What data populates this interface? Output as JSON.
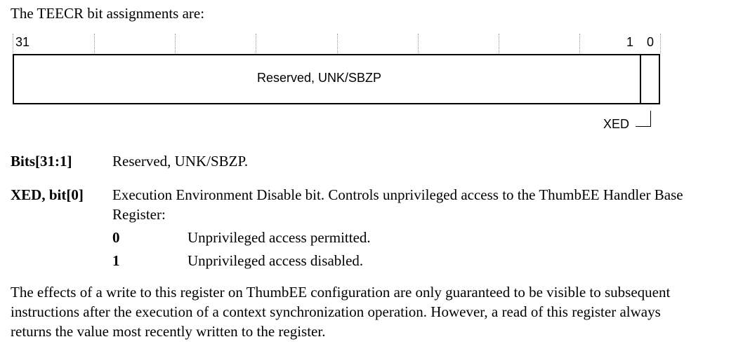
{
  "intro": "The TEECR bit assignments are:",
  "diagram": {
    "bit_high": "31",
    "bit_one": "1",
    "bit_zero": "0",
    "reserved_field_label": "Reserved, UNK/SBZP",
    "xed_field_label": "XED"
  },
  "fields": [
    {
      "name": "Bits[31:1]",
      "description": "Reserved, UNK/SBZP."
    },
    {
      "name": "XED, bit[0]",
      "description_line1": "Execution Environment Disable bit. Controls unprivileged access to the ThumbEE Handler Base",
      "description_line2": "Register:",
      "values": [
        {
          "value": "0",
          "meaning": "Unprivileged access permitted."
        },
        {
          "value": "1",
          "meaning": "Unprivileged access disabled."
        }
      ]
    }
  ],
  "footer": {
    "line1": "The effects of a write to this register on ThumbEE configuration are only guaranteed to be visible to subsequent",
    "line2": "instructions after the execution of a context synchronization operation. However, a read of this register always",
    "line3": "returns the value most recently written to the register."
  }
}
